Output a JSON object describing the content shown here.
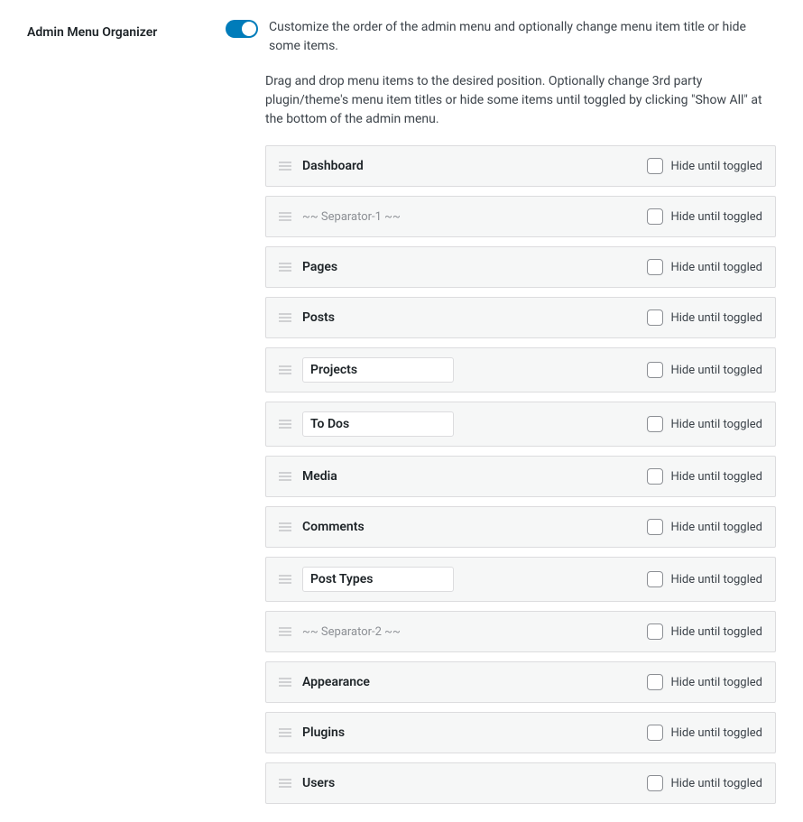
{
  "header": {
    "title": "Admin Menu Organizer",
    "description": "Customize the order of the admin menu and optionally change menu item title or hide some items.",
    "helper": "Drag and drop menu items to the desired position. Optionally change 3rd party plugin/theme's menu item titles or hide some items until toggled by clicking \"Show All\" at the bottom of the admin menu."
  },
  "toggle_on": true,
  "hide_label": "Hide until toggled",
  "items": [
    {
      "label": "Dashboard",
      "editable": false,
      "separator": false
    },
    {
      "label": "~~ Separator-1 ~~",
      "editable": false,
      "separator": true
    },
    {
      "label": "Pages",
      "editable": false,
      "separator": false
    },
    {
      "label": "Posts",
      "editable": false,
      "separator": false
    },
    {
      "label": "Projects",
      "editable": true,
      "separator": false
    },
    {
      "label": "To Dos",
      "editable": true,
      "separator": false
    },
    {
      "label": "Media",
      "editable": false,
      "separator": false
    },
    {
      "label": "Comments",
      "editable": false,
      "separator": false
    },
    {
      "label": "Post Types",
      "editable": true,
      "separator": false
    },
    {
      "label": "~~ Separator-2 ~~",
      "editable": false,
      "separator": true
    },
    {
      "label": "Appearance",
      "editable": false,
      "separator": false
    },
    {
      "label": "Plugins",
      "editable": false,
      "separator": false
    },
    {
      "label": "Users",
      "editable": false,
      "separator": false
    }
  ]
}
